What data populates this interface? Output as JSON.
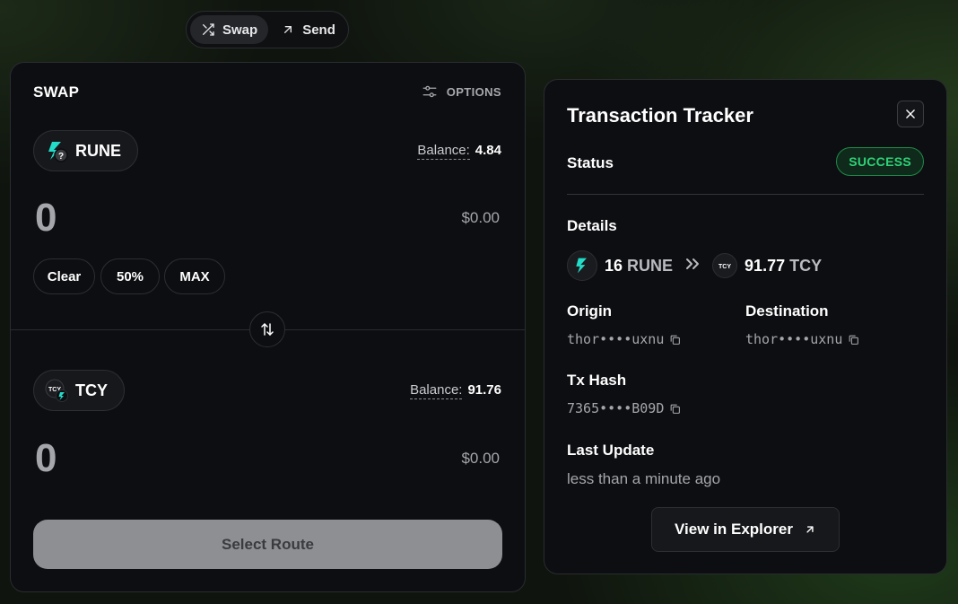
{
  "mode_toggle": {
    "swap_label": "Swap",
    "send_label": "Send",
    "active": "Swap"
  },
  "swap": {
    "title": "SWAP",
    "options_label": "OPTIONS",
    "from": {
      "token": "RUNE",
      "balance_label": "Balance:",
      "balance_value": "4.84",
      "amount": "0",
      "usd_value": "$0.00"
    },
    "quick_buttons": [
      "Clear",
      "50%",
      "MAX"
    ],
    "to": {
      "token": "TCY",
      "balance_label": "Balance:",
      "balance_value": "91.76",
      "amount": "0",
      "usd_value": "$0.00"
    },
    "route_button_label": "Select Route"
  },
  "tracker": {
    "title": "Transaction Tracker",
    "status_label": "Status",
    "status_value": "SUCCESS",
    "details_label": "Details",
    "from_amount": "16",
    "from_symbol": "RUNE",
    "to_amount": "91.77",
    "to_symbol": "TCY",
    "origin_label": "Origin",
    "origin_value": "thor••••uxnu",
    "destination_label": "Destination",
    "destination_value": "thor••••uxnu",
    "tx_hash_label": "Tx Hash",
    "tx_hash_value": "7365••••B09D",
    "last_update_label": "Last Update",
    "last_update_value": "less than a minute ago",
    "explorer_button_label": "View in Explorer"
  },
  "colors": {
    "success": "#2fd277",
    "rune_accent": "#23dcc8",
    "card_bg": "#0d0e11",
    "disabled_button": "#8e8f92"
  },
  "icons": [
    "shuffle-icon",
    "arrow-up-right-icon",
    "sliders-icon",
    "swap-vertical-icon",
    "close-icon",
    "copy-icon",
    "double-chevron-icon",
    "rune-logo-icon",
    "tcy-logo-icon"
  ]
}
